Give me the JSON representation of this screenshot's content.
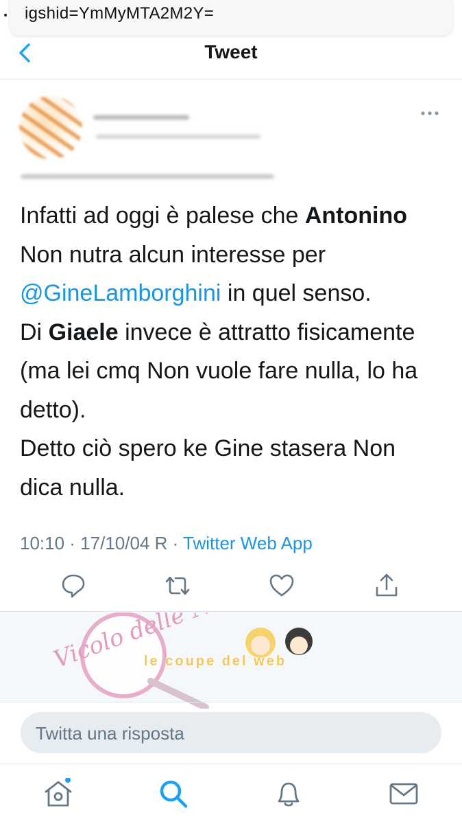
{
  "url_bar": {
    "text": "igshid=YmMyMTA2M2Y="
  },
  "nav": {
    "title": "Tweet"
  },
  "tweet": {
    "lines": [
      [
        {
          "t": "Infatti ad oggi è  palese che "
        },
        {
          "t": "Antonino",
          "b": true
        }
      ],
      [
        {
          "t": "Non nutra alcun interesse per"
        }
      ],
      [
        {
          "t": "@GineLamborghini",
          "m": true
        },
        {
          "t": " in quel senso."
        }
      ],
      [
        {
          "t": "Di "
        },
        {
          "t": "Giaele",
          "b": true
        },
        {
          "t": " invece è attratto fisicamente"
        }
      ],
      [
        {
          "t": "(ma lei cmq Non vuole fare nulla, lo ha"
        }
      ],
      [
        {
          "t": "detto)."
        }
      ],
      [
        {
          "t": "Detto ciò spero ke Gine stasera Non"
        }
      ],
      [
        {
          "t": "dica nulla."
        }
      ]
    ],
    "time": "10:10 · 17/10/04 R · ",
    "source": "Twitter Web App"
  },
  "watermark": {
    "logo_text": "Vicolo delle News",
    "band_text": "le coupe del web"
  },
  "reply": {
    "placeholder": "Twitta una risposta"
  },
  "tabbar": {
    "items": [
      "home",
      "search",
      "notifications",
      "messages"
    ]
  },
  "colors": {
    "link": "#1b95e0",
    "muted": "#657786",
    "text": "#14171a"
  },
  "icons": {
    "back": "chevron-left-icon",
    "more": "more-horizontal-icon",
    "reply": "comment-icon",
    "retweet": "retweet-icon",
    "like": "heart-icon",
    "share": "share-icon",
    "home": "home-icon",
    "search": "search-icon",
    "notifications": "bell-icon",
    "messages": "mail-icon"
  }
}
